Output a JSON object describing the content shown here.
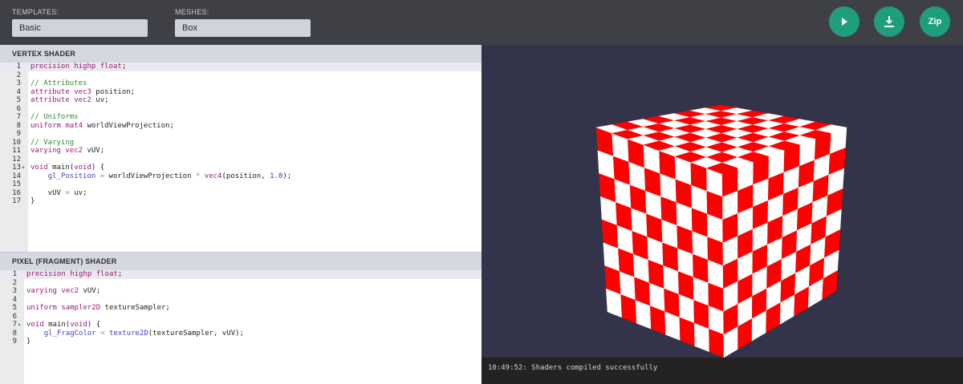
{
  "toolbar": {
    "templates_label": "TEMPLATES:",
    "templates_value": "Basic",
    "meshes_label": "MESHES:",
    "meshes_value": "Box",
    "run_icon": "play-icon",
    "download_icon": "download-icon",
    "zip_label": "Zip",
    "accent_color": "#1f9e7e"
  },
  "vertex": {
    "title": "VERTEX SHADER",
    "lines": [
      "precision highp float;",
      "",
      "// Attributes",
      "attribute vec3 position;",
      "attribute vec2 uv;",
      "",
      "// Uniforms",
      "uniform mat4 worldViewProjection;",
      "",
      "// Varying",
      "varying vec2 vUV;",
      "",
      "void main(void) {",
      "    gl_Position = worldViewProjection * vec4(position, 1.0);",
      "",
      "    vUV = uv;",
      "}"
    ]
  },
  "fragment": {
    "title": "PIXEL (FRAGMENT) SHADER",
    "lines": [
      "precision highp float;",
      "",
      "varying vec2 vUV;",
      "",
      "uniform sampler2D textureSampler;",
      "",
      "void main(void) {",
      "    gl_FragColor = texture2D(textureSampler, vUV);",
      "}"
    ]
  },
  "preview": {
    "checker_colors": [
      "#ff0000",
      "#ffffff"
    ],
    "background": "#33334a"
  },
  "console": {
    "message": "10:49:52: Shaders compiled successfully"
  }
}
